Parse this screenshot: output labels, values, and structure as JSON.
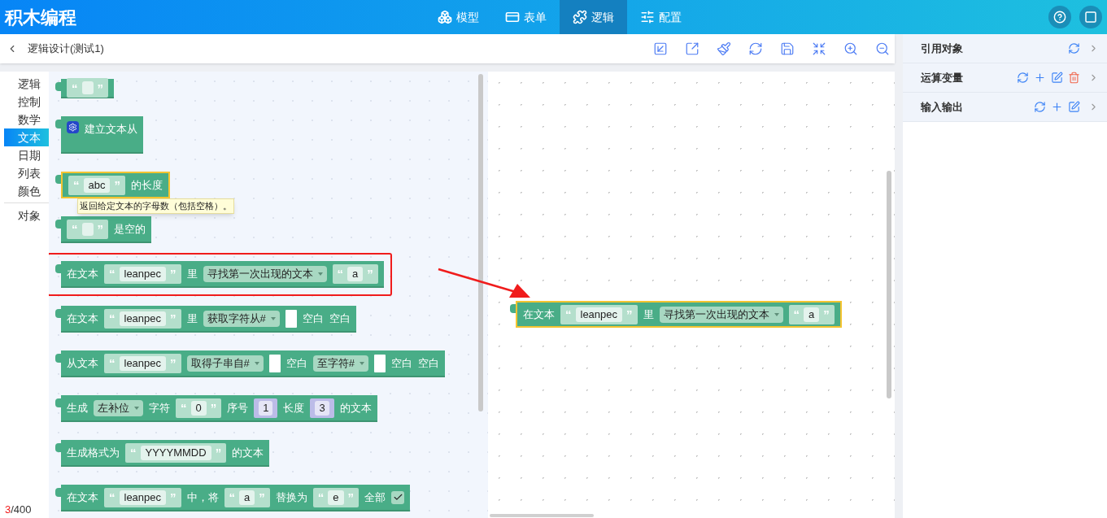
{
  "app": {
    "title": "积木编程"
  },
  "nav": [
    {
      "label": "模型",
      "kind": "model",
      "selected": false
    },
    {
      "label": "表单",
      "kind": "form",
      "selected": false
    },
    {
      "label": "逻辑",
      "kind": "logic",
      "selected": true
    },
    {
      "label": "配置",
      "kind": "config",
      "selected": false
    }
  ],
  "header_buttons": [
    {
      "kind": "help"
    },
    {
      "kind": "window"
    }
  ],
  "page": {
    "title": "逻辑设计(测试1)"
  },
  "categories": [
    {
      "label": "逻辑",
      "selected": false,
      "separated": false
    },
    {
      "label": "控制",
      "selected": false,
      "separated": false
    },
    {
      "label": "数学",
      "selected": false,
      "separated": false
    },
    {
      "label": "文本",
      "selected": true,
      "separated": false
    },
    {
      "label": "日期",
      "selected": false,
      "separated": false
    },
    {
      "label": "列表",
      "selected": false,
      "separated": false
    },
    {
      "label": "颜色",
      "selected": false,
      "separated": false
    },
    {
      "label": "对象",
      "selected": false,
      "separated": true
    }
  ],
  "counter": {
    "count": "3",
    "limit": "/400"
  },
  "annotation_arrow": true,
  "flyout": {
    "blocks": [
      {
        "selected": false,
        "highlighted": false,
        "tall": false,
        "parts": [
          {
            "kind": "text",
            "open": "“",
            "close": "”"
          }
        ]
      },
      {
        "selected": false,
        "highlighted": false,
        "tall": true,
        "parts": [
          {
            "kind": "gear"
          },
          {
            "kind": "label",
            "text": "建立文本从"
          }
        ]
      },
      {
        "selected": true,
        "highlighted": false,
        "tall": false,
        "tooltip": "返回给定文本的字母数（包括空格）。",
        "parts": [
          {
            "kind": "text",
            "open": "“",
            "value": "abc",
            "close": "”"
          },
          {
            "kind": "label",
            "text": "的长度"
          }
        ]
      },
      {
        "selected": false,
        "highlighted": false,
        "tall": false,
        "parts": [
          {
            "kind": "text",
            "open": "“",
            "close": "”"
          },
          {
            "kind": "label",
            "text": "是空的"
          }
        ]
      },
      {
        "selected": false,
        "highlighted": true,
        "tall": false,
        "parts": [
          {
            "kind": "label",
            "text": "在文本"
          },
          {
            "kind": "text",
            "open": "“",
            "value": "leanpec",
            "close": "”"
          },
          {
            "kind": "label",
            "text": "里"
          },
          {
            "kind": "dropdown",
            "text": "寻找第一次出现的文本"
          },
          {
            "kind": "text",
            "open": "“",
            "value": "a",
            "close": "”"
          }
        ]
      },
      {
        "selected": false,
        "highlighted": false,
        "tall": false,
        "parts": [
          {
            "kind": "label",
            "text": "在文本"
          },
          {
            "kind": "text",
            "open": "“",
            "value": "leanpec",
            "close": "”"
          },
          {
            "kind": "label",
            "text": "里"
          },
          {
            "kind": "dropdown",
            "text": "获取字符从#"
          },
          {
            "kind": "socket"
          },
          {
            "kind": "label",
            "text": "空白"
          },
          {
            "kind": "label",
            "text": "空白"
          }
        ]
      },
      {
        "selected": false,
        "highlighted": false,
        "tall": false,
        "parts": [
          {
            "kind": "label",
            "text": "从文本"
          },
          {
            "kind": "text",
            "open": "“",
            "value": "leanpec",
            "close": "”"
          },
          {
            "kind": "dropdown",
            "text": "取得子串自#"
          },
          {
            "kind": "socket"
          },
          {
            "kind": "label",
            "text": "空白"
          },
          {
            "kind": "dropdown",
            "text": "至字符#"
          },
          {
            "kind": "socket"
          },
          {
            "kind": "label",
            "text": "空白"
          },
          {
            "kind": "label",
            "text": "空白"
          }
        ]
      },
      {
        "selected": false,
        "highlighted": false,
        "tall": false,
        "parts": [
          {
            "kind": "label",
            "text": "生成"
          },
          {
            "kind": "dropdown",
            "text": "左补位"
          },
          {
            "kind": "label",
            "text": "字符"
          },
          {
            "kind": "text",
            "open": "“",
            "value": "0",
            "close": "”"
          },
          {
            "kind": "label",
            "text": "序号"
          },
          {
            "kind": "number",
            "value": "1"
          },
          {
            "kind": "label",
            "text": "长度"
          },
          {
            "kind": "number",
            "value": "3"
          },
          {
            "kind": "label",
            "text": "的文本"
          }
        ]
      },
      {
        "selected": false,
        "highlighted": false,
        "tall": false,
        "parts": [
          {
            "kind": "label",
            "text": "生成格式为"
          },
          {
            "kind": "text",
            "open": "“",
            "value": "YYYYMMDD",
            "close": "”"
          },
          {
            "kind": "label",
            "text": "的文本"
          }
        ]
      },
      {
        "selected": false,
        "highlighted": false,
        "tall": false,
        "parts": [
          {
            "kind": "label",
            "text": "在文本"
          },
          {
            "kind": "text",
            "open": "“",
            "value": "leanpec",
            "close": "”"
          },
          {
            "kind": "label",
            "text": "中，将"
          },
          {
            "kind": "text",
            "open": "“",
            "value": "a",
            "close": "”"
          },
          {
            "kind": "label",
            "text": "替换为"
          },
          {
            "kind": "text",
            "open": "“",
            "value": "e",
            "close": "”"
          },
          {
            "kind": "label",
            "text": "全部"
          },
          {
            "kind": "checkbox",
            "checked": true
          }
        ]
      }
    ]
  },
  "canvas": {
    "blocks": [
      {
        "selected": true,
        "highlighted": false,
        "tall": false,
        "parts": [
          {
            "kind": "label",
            "text": "在文本"
          },
          {
            "kind": "text",
            "open": "“",
            "value": "leanpec",
            "close": "”"
          },
          {
            "kind": "label",
            "text": "里"
          },
          {
            "kind": "dropdown",
            "text": "寻找第一次出现的文本"
          },
          {
            "kind": "text",
            "open": "“",
            "value": "a",
            "close": "”"
          }
        ]
      }
    ]
  },
  "panel": {
    "sections": [
      {
        "title": "引用对象",
        "actions": [
          {
            "kind": "refresh"
          }
        ]
      },
      {
        "title": "运算变量",
        "actions": [
          {
            "kind": "refresh"
          },
          {
            "kind": "add"
          },
          {
            "kind": "edit"
          },
          {
            "kind": "delete"
          }
        ]
      },
      {
        "title": "输入输出",
        "actions": [
          {
            "kind": "refresh"
          },
          {
            "kind": "add"
          },
          {
            "kind": "edit"
          }
        ]
      }
    ]
  }
}
